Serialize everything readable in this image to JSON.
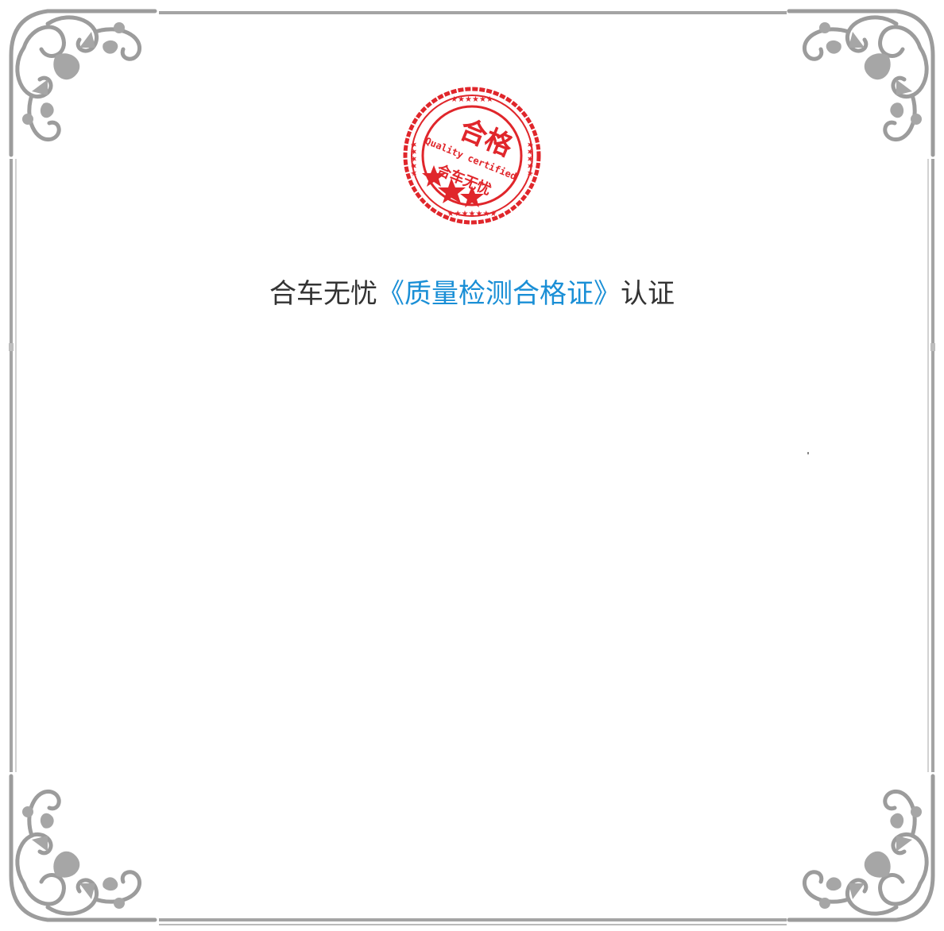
{
  "seal": {
    "main_text": "合格",
    "english_text": "Quality certified",
    "brand_text": "合车无忧",
    "color": "#e0262b"
  },
  "certificate": {
    "prefix": "合车无忧",
    "highlight": "《质量检测合格证》",
    "suffix": "认证",
    "text_color": "#333333",
    "highlight_color": "#1a8fd6"
  },
  "frame": {
    "color": "#9e9e9e",
    "ornament": "floral-corner-ornament"
  }
}
